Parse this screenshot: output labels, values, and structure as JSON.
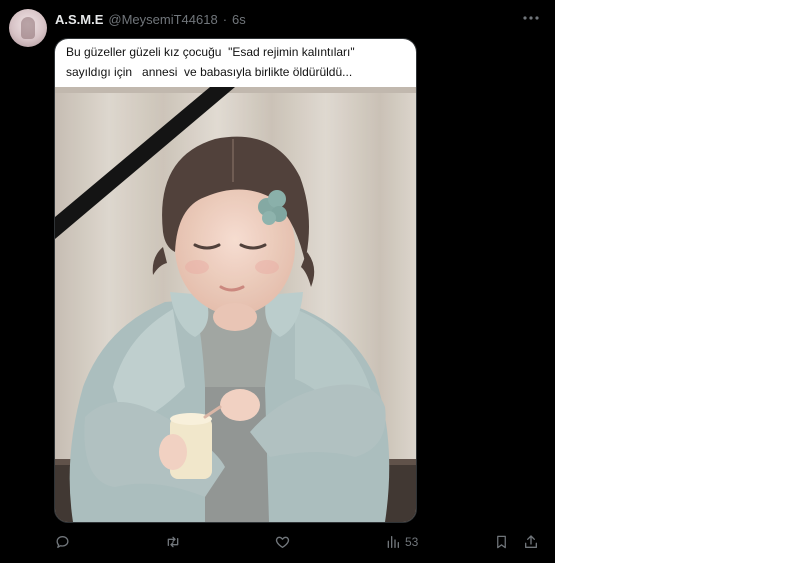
{
  "tweet": {
    "author_name": "A.S.M.E",
    "author_handle": "@MeysemiT44618",
    "separator": "·",
    "time": "6s",
    "more_icon": "more-horizontal-icon"
  },
  "media": {
    "caption_line1": "Bu güzeller güzeli kız çocuğu  \"Esad rejimin kalıntıları\"",
    "caption_line2": "sayıldıgı için   annesi  ve babasıyla birlikte öldürüldü..."
  },
  "actions": {
    "reply_icon": "reply-icon",
    "retweet_icon": "retweet-icon",
    "like_icon": "heart-icon",
    "views_icon": "views-chart-icon",
    "views_count": "53",
    "bookmark_icon": "bookmark-icon",
    "share_icon": "share-icon"
  },
  "colors": {
    "background": "#000000",
    "text_primary": "#e7e9ea",
    "text_secondary": "#71767b",
    "page_right": "#ffffff"
  }
}
